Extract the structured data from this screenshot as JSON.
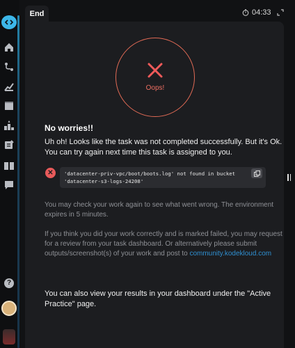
{
  "sidebar": {
    "items": [
      {
        "icon": "home-icon"
      },
      {
        "icon": "route-icon"
      },
      {
        "icon": "chart-icon"
      },
      {
        "icon": "video-icon"
      },
      {
        "icon": "leaderboard-icon"
      },
      {
        "icon": "notes-icon"
      },
      {
        "icon": "book-icon"
      },
      {
        "icon": "chat-icon"
      }
    ],
    "help_label": "?"
  },
  "tab": {
    "label": "End"
  },
  "timer": {
    "value": "04:33"
  },
  "result": {
    "status_text": "Oops!",
    "title": "No worries!!",
    "message": "Uh oh! Looks like the task was not completed successfully. But it's Ok. You can try again next time this task is assigned to you.",
    "error_line1": "'datacenter-priv-vpc/boot/boots.log' not found in bucket",
    "error_line2": "'datacenter-s3-logs-24208'",
    "check_text": "You may check your work again to see what went wrong. The environment expires in 5 minutes.",
    "review_text": "If you think you did your work correctly and is marked failed, you may request for a review from your task dashboard. Or alternatively please submit outputs/screenshot(s) of your work and post to",
    "review_link": "community.kodekloud.com",
    "dashboard_text": "You can also view your results in your dashboard under the \"Active Practice\" page."
  },
  "colors": {
    "accent": "#3db7e9",
    "error": "#e85a5a",
    "panel": "#1c1d20",
    "link": "#2f8fd0"
  }
}
